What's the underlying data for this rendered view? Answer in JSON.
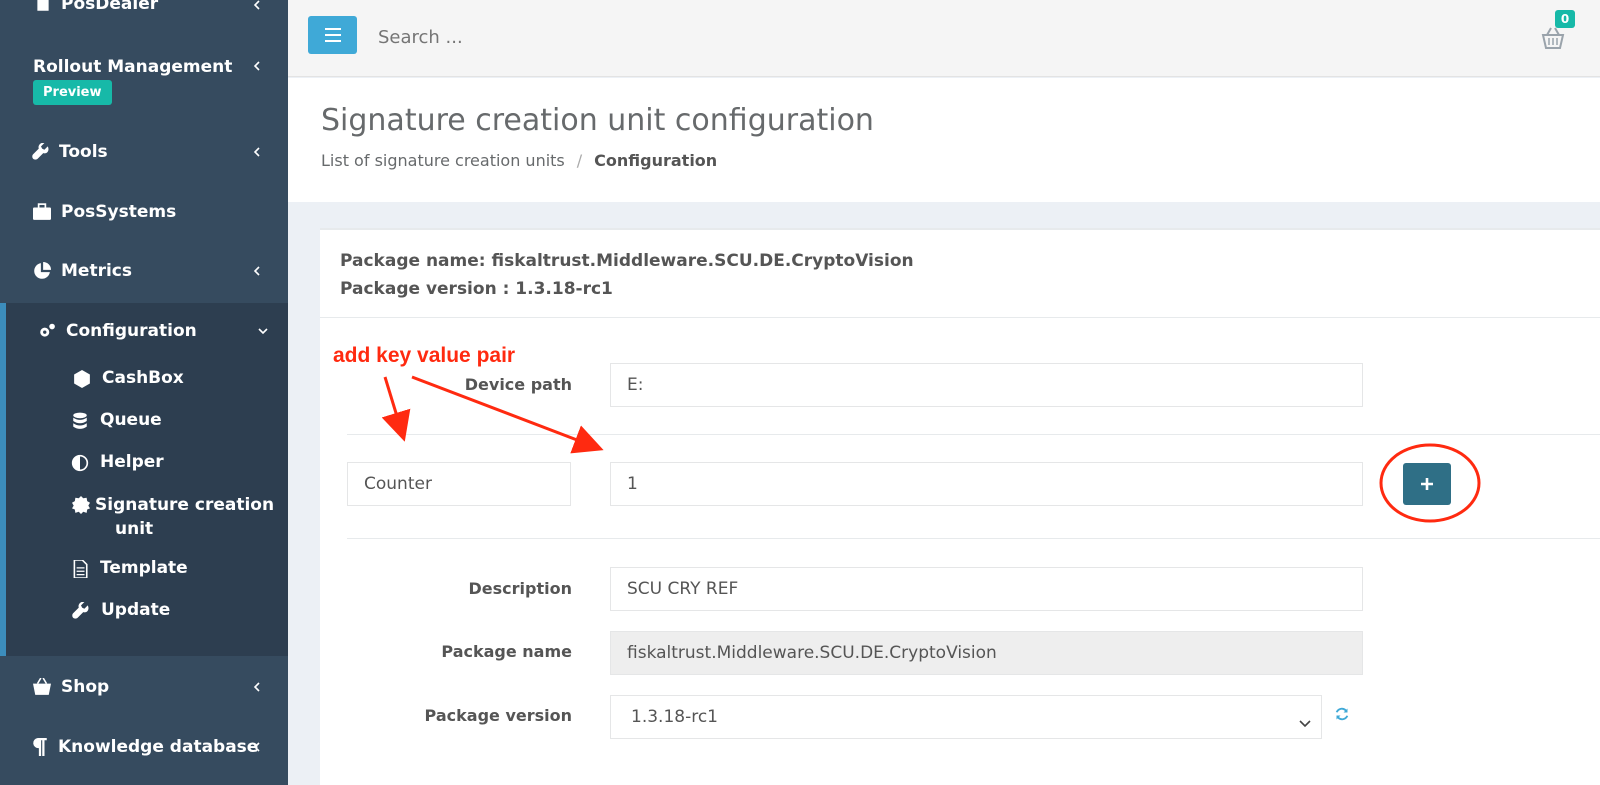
{
  "sidebar": {
    "items": [
      {
        "label": "PosDealer",
        "icon": "building-icon",
        "has_chevron": true
      },
      {
        "label": "Rollout Management",
        "badge": "Preview",
        "has_chevron": true
      },
      {
        "label": "Tools",
        "icon": "wrench-icon",
        "has_chevron": true
      },
      {
        "label": "PosSystems",
        "icon": "briefcase-icon",
        "has_chevron": false
      },
      {
        "label": "Metrics",
        "icon": "pie-chart-icon",
        "has_chevron": true
      },
      {
        "label": "Configuration",
        "icon": "cogs-icon",
        "expanded": true
      },
      {
        "label": "Shop",
        "icon": "basket-icon",
        "has_chevron": true
      },
      {
        "label": "Knowledge database",
        "icon": "paragraph-icon",
        "has_chevron": true
      }
    ],
    "config_sub": [
      {
        "label": "CashBox",
        "icon": "cube-icon"
      },
      {
        "label": "Queue",
        "icon": "database-icon"
      },
      {
        "label": "Helper",
        "icon": "adjust-icon"
      },
      {
        "label": "Signature creation unit",
        "label_line1": "Signature creation",
        "label_line2": "unit",
        "icon": "certificate-icon",
        "active": true
      },
      {
        "label": "Template",
        "icon": "file-icon"
      },
      {
        "label": "Update",
        "icon": "wrench-icon"
      }
    ]
  },
  "topbar": {
    "search_placeholder": "Search ...",
    "cart_count": "0"
  },
  "header": {
    "title": "Signature creation unit configuration",
    "breadcrumb": {
      "parent": "List of signature creation units",
      "separator": "/",
      "current": "Configuration"
    }
  },
  "package": {
    "name_line": "Package name: fiskaltrust.Middleware.SCU.DE.CryptoVision",
    "version_line": "Package version : 1.3.18-rc1"
  },
  "form": {
    "device_path": {
      "label": "Device path",
      "value": "E:"
    },
    "new_pair": {
      "key": "Counter",
      "value": "1"
    },
    "description": {
      "label": "Description",
      "value": "SCU CRY REF"
    },
    "package_name": {
      "label": "Package name",
      "value": "fiskaltrust.Middleware.SCU.DE.CryptoVision"
    },
    "package_version": {
      "label": "Package version",
      "value": "1.3.18-rc1"
    }
  },
  "annotation": {
    "text": "add key value pair",
    "color": "#ff2a10"
  },
  "colors": {
    "sidebar_bg": "#364b5f",
    "sidebar_active_bg": "#2d3e50",
    "accent": "#3fa9d7",
    "badge": "#17b9a8",
    "plus_button": "#2f6f86"
  }
}
